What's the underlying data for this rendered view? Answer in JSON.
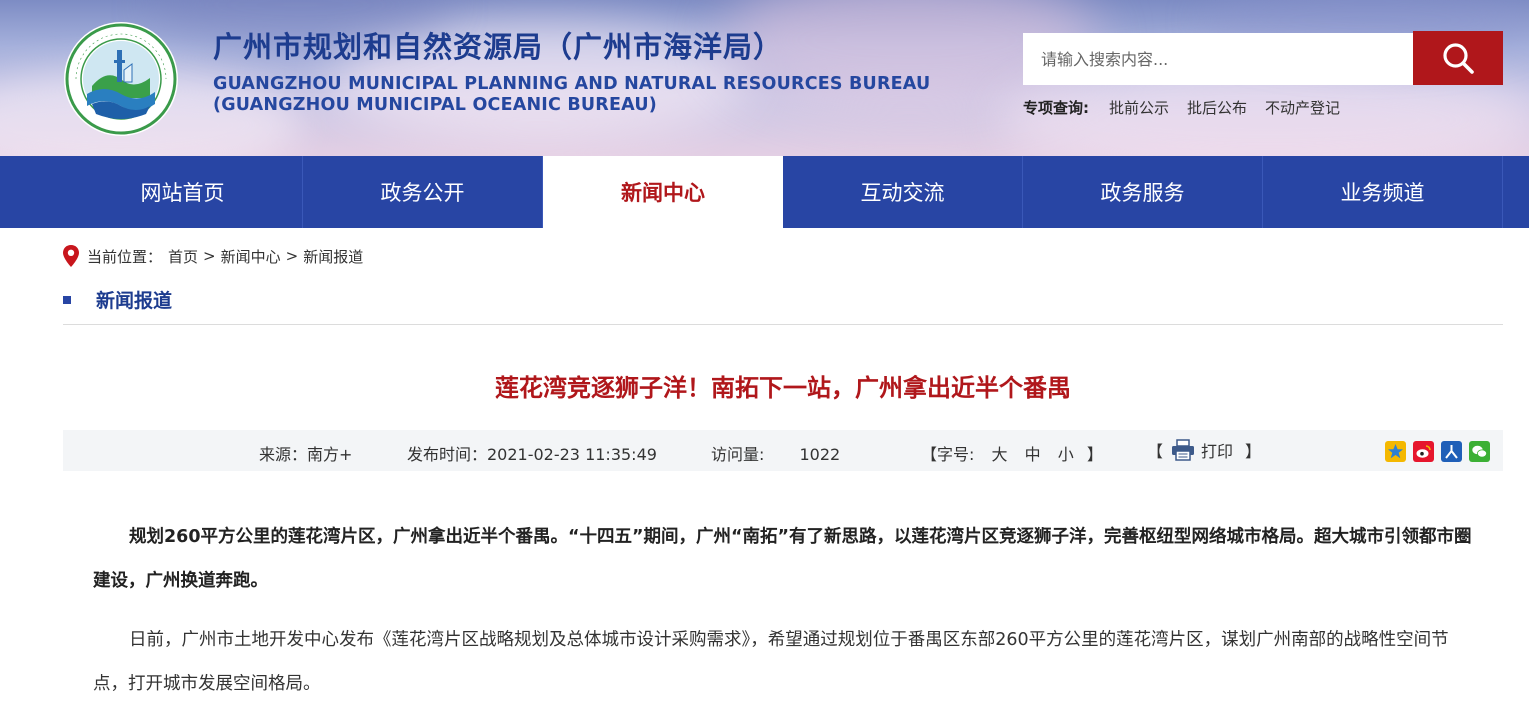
{
  "header": {
    "org_name_cn": "广州市规划和自然资源局（广州市海洋局）",
    "org_name_en_line1": "GUANGZHOU MUNICIPAL PLANNING AND NATURAL RESOURCES BUREAU",
    "org_name_en_line2": "(GUANGZHOU MUNICIPAL OCEANIC BUREAU)",
    "logo_icon": "bureau-emblem-icon",
    "search": {
      "placeholder": "请输入搜索内容...",
      "value": "",
      "button_icon": "search-icon"
    },
    "special_query": {
      "label": "专项查询:",
      "links": [
        "批前公示",
        "批后公布",
        "不动产登记"
      ]
    }
  },
  "nav": {
    "items": [
      "网站首页",
      "政务公开",
      "新闻中心",
      "互动交流",
      "政务服务",
      "业务频道"
    ],
    "active": "新闻中心"
  },
  "breadcrumb": {
    "label": "当前位置：",
    "items": [
      "首页",
      "新闻中心",
      "新闻报道"
    ],
    "separator": ">"
  },
  "section": {
    "title": "新闻报道"
  },
  "article": {
    "title": "莲花湾竞逐狮子洋！南拓下一站，广州拿出近半个番禺",
    "meta": {
      "source": "来源：南方+",
      "publish_time": "发布时间：2021-02-23 11:35:49",
      "visits_label": "访问量:",
      "visits_value": "1022",
      "font_size_open": "【字号:",
      "font_large": "大",
      "font_medium": "中",
      "font_small": "小",
      "font_size_close": "】",
      "print_open": "【",
      "print_label": "打印",
      "print_close": "】",
      "print_icon": "printer-icon",
      "share_icons": [
        "qzone-icon",
        "weibo-icon",
        "renren-icon",
        "wechat-icon"
      ]
    },
    "paragraphs": [
      "规划260平方公里的莲花湾片区，广州拿出近半个番禺。“十四五”期间，广州“南拓”有了新思路，以莲花湾片区竞逐狮子洋，完善枢纽型网络城市格局。超大城市引领都市圈建设，广州换道奔跑。",
      "日前，广州市土地开发中心发布《莲花湾片区战略规划及总体城市设计采购需求》，希望通过规划位于番禺区东部260平方公里的莲花湾片区，谋划广州南部的战略性空间节点，打开城市发展空间格局。"
    ]
  },
  "colors": {
    "nav_bg": "#2845a4",
    "accent_red": "#b0171b",
    "title_blue": "#1d3c8f",
    "meta_bg": "#f3f5f7"
  }
}
